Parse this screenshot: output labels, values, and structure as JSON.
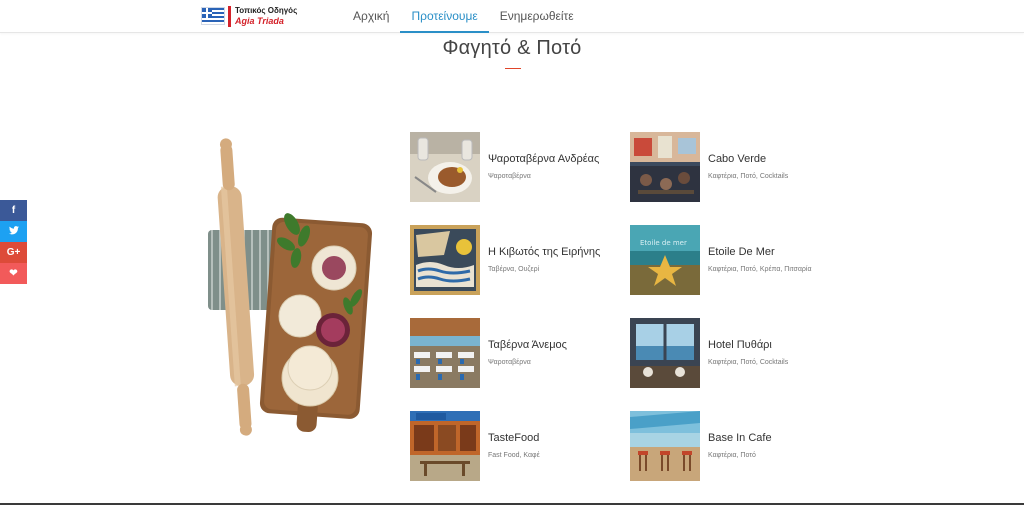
{
  "header": {
    "logo_line1": "Τοπικός Οδηγός",
    "logo_line2": "Agia Triada",
    "nav": [
      {
        "label": "Αρχική"
      },
      {
        "label": "Προτείνουμε"
      },
      {
        "label": "Ενημερωθείτε"
      }
    ],
    "active_nav": "Προτείνουμε"
  },
  "section": {
    "title": "Φαγητό & Ποτό"
  },
  "social": [
    {
      "label": "f",
      "icon": "facebook-icon"
    },
    {
      "label": "🐦",
      "icon": "twitter-icon"
    },
    {
      "label": "G+",
      "icon": "google-plus-icon"
    },
    {
      "label": "❤",
      "icon": "heart-icon"
    }
  ],
  "places": [
    {
      "name": "Ψαροταβέρνα Ανδρέας",
      "category": "Ψαροταβέρνα"
    },
    {
      "name": "Cabo Verde",
      "category": "Καφτέρια, Ποτό, Cocktails"
    },
    {
      "name": "Η Κιβωτός της Ειρήνης",
      "category": "Ταβέρνα, Ουζερί"
    },
    {
      "name": "Etoile De Mer",
      "category": "Καφτέρια, Ποτό, Κρέπα, Πιτσαρία"
    },
    {
      "name": "Ταβέρνα Άνεμος",
      "category": "Ψαροταβέρνα"
    },
    {
      "name": "Hotel Πυθάρι",
      "category": "Καφτέρια, Ποτό, Cocktails"
    },
    {
      "name": "TasteFood",
      "category": "Fast Food, Καφέ"
    },
    {
      "name": "Base In Cafe",
      "category": "Καφτέρια, Ποτό"
    }
  ],
  "colors": {
    "accent": "#2a8fc7",
    "brand_red": "#d4222a"
  }
}
